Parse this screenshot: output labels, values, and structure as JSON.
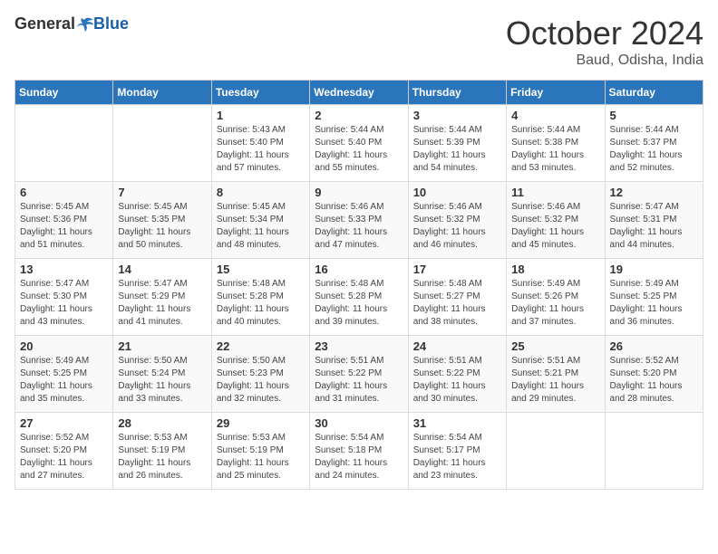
{
  "logo": {
    "general": "General",
    "blue": "Blue"
  },
  "header": {
    "month": "October 2024",
    "location": "Baud, Odisha, India"
  },
  "weekdays": [
    "Sunday",
    "Monday",
    "Tuesday",
    "Wednesday",
    "Thursday",
    "Friday",
    "Saturday"
  ],
  "weeks": [
    [
      {
        "day": "",
        "detail": ""
      },
      {
        "day": "",
        "detail": ""
      },
      {
        "day": "1",
        "detail": "Sunrise: 5:43 AM\nSunset: 5:40 PM\nDaylight: 11 hours and 57 minutes."
      },
      {
        "day": "2",
        "detail": "Sunrise: 5:44 AM\nSunset: 5:40 PM\nDaylight: 11 hours and 55 minutes."
      },
      {
        "day": "3",
        "detail": "Sunrise: 5:44 AM\nSunset: 5:39 PM\nDaylight: 11 hours and 54 minutes."
      },
      {
        "day": "4",
        "detail": "Sunrise: 5:44 AM\nSunset: 5:38 PM\nDaylight: 11 hours and 53 minutes."
      },
      {
        "day": "5",
        "detail": "Sunrise: 5:44 AM\nSunset: 5:37 PM\nDaylight: 11 hours and 52 minutes."
      }
    ],
    [
      {
        "day": "6",
        "detail": "Sunrise: 5:45 AM\nSunset: 5:36 PM\nDaylight: 11 hours and 51 minutes."
      },
      {
        "day": "7",
        "detail": "Sunrise: 5:45 AM\nSunset: 5:35 PM\nDaylight: 11 hours and 50 minutes."
      },
      {
        "day": "8",
        "detail": "Sunrise: 5:45 AM\nSunset: 5:34 PM\nDaylight: 11 hours and 48 minutes."
      },
      {
        "day": "9",
        "detail": "Sunrise: 5:46 AM\nSunset: 5:33 PM\nDaylight: 11 hours and 47 minutes."
      },
      {
        "day": "10",
        "detail": "Sunrise: 5:46 AM\nSunset: 5:32 PM\nDaylight: 11 hours and 46 minutes."
      },
      {
        "day": "11",
        "detail": "Sunrise: 5:46 AM\nSunset: 5:32 PM\nDaylight: 11 hours and 45 minutes."
      },
      {
        "day": "12",
        "detail": "Sunrise: 5:47 AM\nSunset: 5:31 PM\nDaylight: 11 hours and 44 minutes."
      }
    ],
    [
      {
        "day": "13",
        "detail": "Sunrise: 5:47 AM\nSunset: 5:30 PM\nDaylight: 11 hours and 43 minutes."
      },
      {
        "day": "14",
        "detail": "Sunrise: 5:47 AM\nSunset: 5:29 PM\nDaylight: 11 hours and 41 minutes."
      },
      {
        "day": "15",
        "detail": "Sunrise: 5:48 AM\nSunset: 5:28 PM\nDaylight: 11 hours and 40 minutes."
      },
      {
        "day": "16",
        "detail": "Sunrise: 5:48 AM\nSunset: 5:28 PM\nDaylight: 11 hours and 39 minutes."
      },
      {
        "day": "17",
        "detail": "Sunrise: 5:48 AM\nSunset: 5:27 PM\nDaylight: 11 hours and 38 minutes."
      },
      {
        "day": "18",
        "detail": "Sunrise: 5:49 AM\nSunset: 5:26 PM\nDaylight: 11 hours and 37 minutes."
      },
      {
        "day": "19",
        "detail": "Sunrise: 5:49 AM\nSunset: 5:25 PM\nDaylight: 11 hours and 36 minutes."
      }
    ],
    [
      {
        "day": "20",
        "detail": "Sunrise: 5:49 AM\nSunset: 5:25 PM\nDaylight: 11 hours and 35 minutes."
      },
      {
        "day": "21",
        "detail": "Sunrise: 5:50 AM\nSunset: 5:24 PM\nDaylight: 11 hours and 33 minutes."
      },
      {
        "day": "22",
        "detail": "Sunrise: 5:50 AM\nSunset: 5:23 PM\nDaylight: 11 hours and 32 minutes."
      },
      {
        "day": "23",
        "detail": "Sunrise: 5:51 AM\nSunset: 5:22 PM\nDaylight: 11 hours and 31 minutes."
      },
      {
        "day": "24",
        "detail": "Sunrise: 5:51 AM\nSunset: 5:22 PM\nDaylight: 11 hours and 30 minutes."
      },
      {
        "day": "25",
        "detail": "Sunrise: 5:51 AM\nSunset: 5:21 PM\nDaylight: 11 hours and 29 minutes."
      },
      {
        "day": "26",
        "detail": "Sunrise: 5:52 AM\nSunset: 5:20 PM\nDaylight: 11 hours and 28 minutes."
      }
    ],
    [
      {
        "day": "27",
        "detail": "Sunrise: 5:52 AM\nSunset: 5:20 PM\nDaylight: 11 hours and 27 minutes."
      },
      {
        "day": "28",
        "detail": "Sunrise: 5:53 AM\nSunset: 5:19 PM\nDaylight: 11 hours and 26 minutes."
      },
      {
        "day": "29",
        "detail": "Sunrise: 5:53 AM\nSunset: 5:19 PM\nDaylight: 11 hours and 25 minutes."
      },
      {
        "day": "30",
        "detail": "Sunrise: 5:54 AM\nSunset: 5:18 PM\nDaylight: 11 hours and 24 minutes."
      },
      {
        "day": "31",
        "detail": "Sunrise: 5:54 AM\nSunset: 5:17 PM\nDaylight: 11 hours and 23 minutes."
      },
      {
        "day": "",
        "detail": ""
      },
      {
        "day": "",
        "detail": ""
      }
    ]
  ]
}
